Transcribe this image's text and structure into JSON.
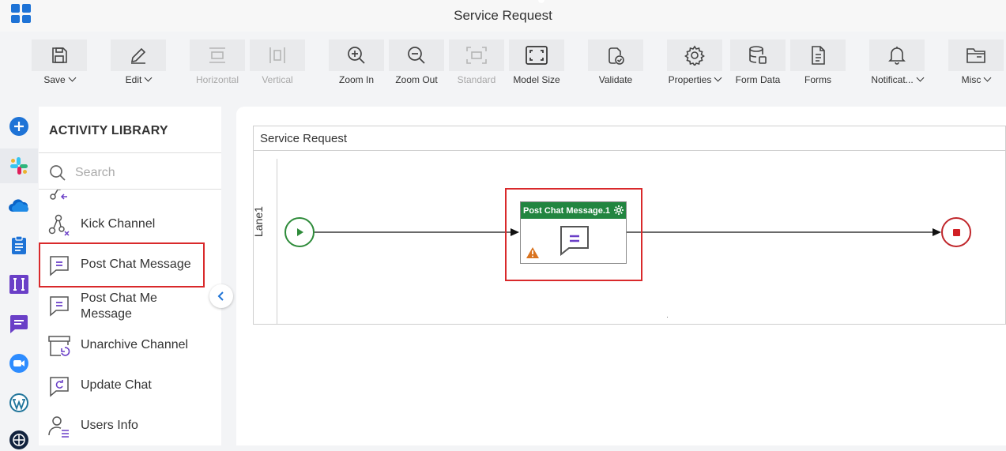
{
  "window": {
    "title": "Service Request"
  },
  "toolbar": {
    "buttons": [
      {
        "label": "Save",
        "icon": "save-icon",
        "has_dropdown": true,
        "enabled": true
      },
      {
        "label": "Edit",
        "icon": "pencil-icon",
        "has_dropdown": true,
        "enabled": true
      },
      {
        "label": "Horizontal",
        "icon": "horizontal-align-icon",
        "has_dropdown": false,
        "enabled": false
      },
      {
        "label": "Vertical",
        "icon": "vertical-align-icon",
        "has_dropdown": false,
        "enabled": false
      },
      {
        "label": "Zoom In",
        "icon": "zoom-in-icon",
        "has_dropdown": false,
        "enabled": true
      },
      {
        "label": "Zoom Out",
        "icon": "zoom-out-icon",
        "has_dropdown": false,
        "enabled": true
      },
      {
        "label": "Standard",
        "icon": "standard-size-icon",
        "has_dropdown": false,
        "enabled": false
      },
      {
        "label": "Model Size",
        "icon": "fit-screen-icon",
        "has_dropdown": false,
        "enabled": true
      },
      {
        "label": "Validate",
        "icon": "validate-icon",
        "has_dropdown": false,
        "enabled": true
      },
      {
        "label": "Properties",
        "icon": "gear-icon",
        "has_dropdown": true,
        "enabled": true
      },
      {
        "label": "Form Data",
        "icon": "database-icon",
        "has_dropdown": false,
        "enabled": true
      },
      {
        "label": "Forms",
        "icon": "forms-icon",
        "has_dropdown": false,
        "enabled": true
      },
      {
        "label": "Notificat...",
        "icon": "bell-icon",
        "has_dropdown": true,
        "enabled": true
      },
      {
        "label": "Misc",
        "icon": "folder-icon",
        "has_dropdown": true,
        "enabled": true
      }
    ]
  },
  "leftbar": {
    "items": [
      {
        "name": "add-icon"
      },
      {
        "name": "slack-icon"
      },
      {
        "name": "onedrive-icon"
      },
      {
        "name": "clipboard-icon"
      },
      {
        "name": "text-integration-icon"
      },
      {
        "name": "chat-icon"
      },
      {
        "name": "zoom-video-icon"
      },
      {
        "name": "wordpress-icon"
      },
      {
        "name": "globe-icon"
      }
    ]
  },
  "library": {
    "title": "ACTIVITY LIBRARY",
    "search_placeholder": "Search",
    "items": [
      {
        "label": "",
        "icon": "channel-arrow-icon"
      },
      {
        "label": "Kick Channel",
        "icon": "kick-channel-icon"
      },
      {
        "label": "Post Chat Message",
        "icon": "chat-message-icon"
      },
      {
        "label": "Post Chat Me Message",
        "icon": "chat-message-icon"
      },
      {
        "label": "Unarchive Channel",
        "icon": "unarchive-icon"
      },
      {
        "label": "Update Chat",
        "icon": "update-chat-icon"
      },
      {
        "label": "Users Info",
        "icon": "users-info-icon"
      }
    ]
  },
  "canvas": {
    "pool_title": "Service Request",
    "lane_label": "Lane1",
    "task": {
      "label": "Post Chat Message.1"
    }
  },
  "colors": {
    "accent_blue": "#1e73d6",
    "task_green": "#228540",
    "start_green": "#2e8b3a",
    "end_red": "#c0262b",
    "highlight_red": "#d9292b",
    "icon_purple": "#6a3fc7",
    "warning_orange": "#d9731f"
  }
}
